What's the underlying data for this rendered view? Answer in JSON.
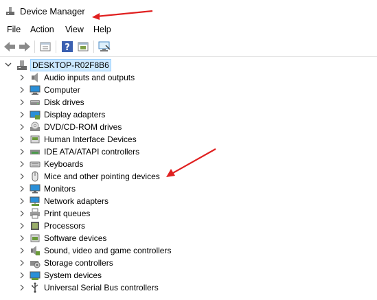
{
  "window": {
    "title": "Device Manager"
  },
  "menu": [
    {
      "label": "File"
    },
    {
      "label": "Action"
    },
    {
      "label": "View"
    },
    {
      "label": "Help"
    }
  ],
  "toolbar": {
    "buttons": [
      "back-arrow-icon",
      "forward-arrow-icon",
      "properties-icon",
      "help-icon",
      "update-driver-icon",
      "scan-hardware-icon"
    ]
  },
  "tree": {
    "root": {
      "label": "DESKTOP-R02F8B6",
      "expanded": true
    },
    "categories": [
      {
        "label": "Audio inputs and outputs",
        "icon": "speaker-icon"
      },
      {
        "label": "Computer",
        "icon": "computer-icon"
      },
      {
        "label": "Disk drives",
        "icon": "disk-drive-icon"
      },
      {
        "label": "Display adapters",
        "icon": "display-adapter-icon"
      },
      {
        "label": "DVD/CD-ROM drives",
        "icon": "dvd-drive-icon"
      },
      {
        "label": "Human Interface Devices",
        "icon": "hid-icon"
      },
      {
        "label": "IDE ATA/ATAPI controllers",
        "icon": "ide-controller-icon"
      },
      {
        "label": "Keyboards",
        "icon": "keyboard-icon"
      },
      {
        "label": "Mice and other pointing devices",
        "icon": "mouse-icon"
      },
      {
        "label": "Monitors",
        "icon": "monitor-icon"
      },
      {
        "label": "Network adapters",
        "icon": "network-adapter-icon"
      },
      {
        "label": "Print queues",
        "icon": "printer-icon"
      },
      {
        "label": "Processors",
        "icon": "processor-icon"
      },
      {
        "label": "Software devices",
        "icon": "software-device-icon"
      },
      {
        "label": "Sound, video and game controllers",
        "icon": "sound-controller-icon"
      },
      {
        "label": "Storage controllers",
        "icon": "storage-controller-icon"
      },
      {
        "label": "System devices",
        "icon": "system-device-icon"
      },
      {
        "label": "Universal Serial Bus controllers",
        "icon": "usb-icon"
      }
    ]
  },
  "colors": {
    "selection_bg": "#cce8ff",
    "selection_border": "#99d1ff",
    "annotation_arrow": "#e02020"
  }
}
